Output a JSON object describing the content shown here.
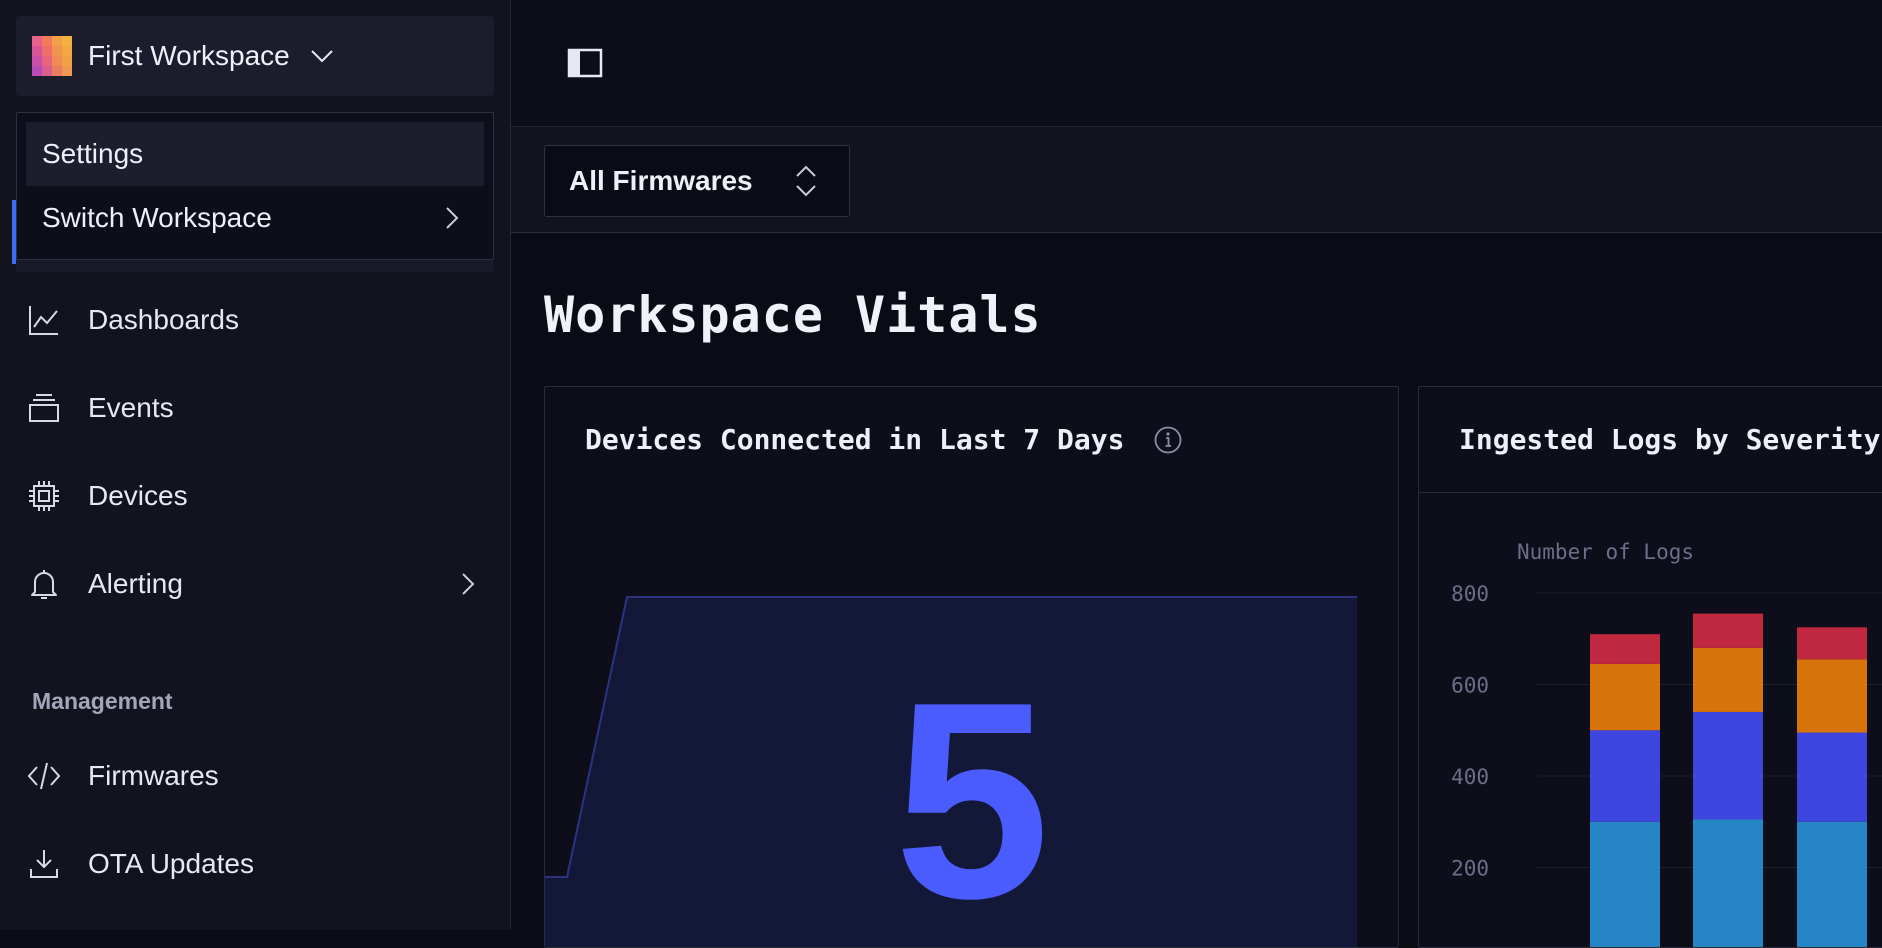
{
  "workspace": {
    "name": "First Workspace"
  },
  "workspace_menu": {
    "items": [
      {
        "label": "Settings"
      },
      {
        "label": "Switch Workspace"
      }
    ]
  },
  "nav": {
    "items": [
      {
        "label": "Dashboards",
        "icon": "chart-line-icon"
      },
      {
        "label": "Events",
        "icon": "stack-icon"
      },
      {
        "label": "Devices",
        "icon": "chip-icon"
      },
      {
        "label": "Alerting",
        "icon": "bell-icon"
      }
    ],
    "section": "Management",
    "management_items": [
      {
        "label": "Firmwares",
        "icon": "code-icon"
      },
      {
        "label": "OTA Updates",
        "icon": "download-icon"
      }
    ]
  },
  "filter": {
    "firmware": "All Firmwares"
  },
  "page": {
    "title": "Workspace Vitals"
  },
  "cards": [
    {
      "title": "Devices Connected in Last 7 Days",
      "value": "5"
    },
    {
      "title": "Ingested Logs by Severity"
    }
  ],
  "colors": {
    "accent": "#4b5cff",
    "bg": "#0a0b14",
    "sidebar": "#12131f"
  },
  "chart_data": [
    {
      "type": "area",
      "title": "Devices Connected in Last 7 Days",
      "big_number": "5",
      "series": [
        {
          "values": [
            1,
            1,
            5,
            5,
            5,
            5,
            5,
            5
          ]
        }
      ],
      "ylim": [
        0,
        8
      ]
    },
    {
      "type": "bar",
      "title": "Ingested Logs by Severity",
      "ylabel": "Number of Logs",
      "yticks": [
        200,
        400,
        600,
        800
      ],
      "ylim": [
        0,
        830
      ],
      "series": [
        {
          "values": [
            300,
            305,
            300
          ],
          "color": "#2585c5"
        },
        {
          "values": [
            200,
            235,
            195
          ],
          "color": "#3f46e0"
        },
        {
          "values": [
            145,
            140,
            160
          ],
          "color": "#d9740a"
        },
        {
          "values": [
            65,
            75,
            70
          ],
          "color": "#c0283f"
        }
      ]
    }
  ]
}
